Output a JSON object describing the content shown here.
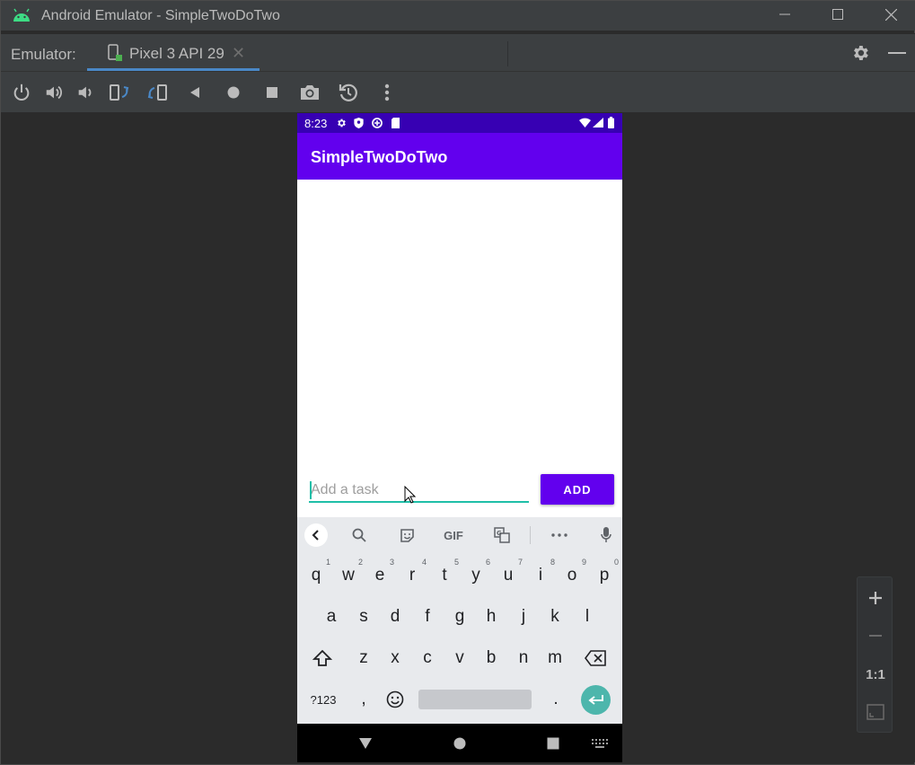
{
  "window": {
    "title": "Android Emulator - SimpleTwoDoTwo"
  },
  "tabbar": {
    "label": "Emulator:",
    "tab_label": "Pixel 3 API 29"
  },
  "phone": {
    "status_time": "8:23",
    "app_title": "SimpleTwoDoTwo",
    "input_placeholder": "Add a task",
    "add_button": "ADD"
  },
  "keyboard": {
    "gif_label": "GIF",
    "row1": [
      {
        "k": "q",
        "n": "1"
      },
      {
        "k": "w",
        "n": "2"
      },
      {
        "k": "e",
        "n": "3"
      },
      {
        "k": "r",
        "n": "4"
      },
      {
        "k": "t",
        "n": "5"
      },
      {
        "k": "y",
        "n": "6"
      },
      {
        "k": "u",
        "n": "7"
      },
      {
        "k": "i",
        "n": "8"
      },
      {
        "k": "o",
        "n": "9"
      },
      {
        "k": "p",
        "n": "0"
      }
    ],
    "row2": [
      "a",
      "s",
      "d",
      "f",
      "g",
      "h",
      "j",
      "k",
      "l"
    ],
    "row3": [
      "z",
      "x",
      "c",
      "v",
      "b",
      "n",
      "m"
    ],
    "symbols_key": "?123",
    "comma_key": ",",
    "period_key": "."
  },
  "zoom": {
    "actual_size": "1:1"
  },
  "colors": {
    "status_bar": "#3700b3",
    "app_bar": "#6200ee",
    "accent": "#1fbfa8",
    "ide_bg": "#2b2b2b",
    "ide_panel": "#3c3f41"
  }
}
